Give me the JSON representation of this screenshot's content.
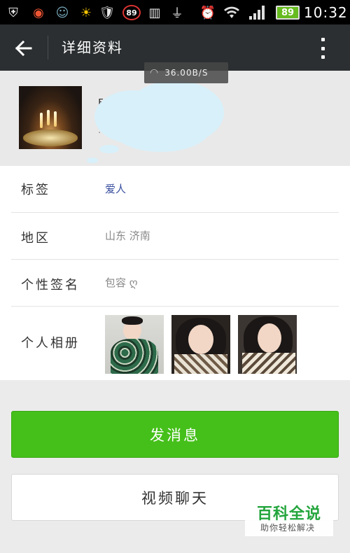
{
  "status_bar": {
    "notification_badge": "89",
    "battery_level": "89",
    "time": "10:32"
  },
  "header": {
    "title": "详细资料"
  },
  "network_overlay": {
    "speed": "36.00B/S"
  },
  "profile": {
    "rows": {
      "tag": {
        "label": "标签",
        "value": "爱人"
      },
      "region": {
        "label": "地区",
        "value": "山东 济南"
      },
      "signature": {
        "label": "个性签名",
        "value": "包容 ღ"
      },
      "album": {
        "label": "个人相册"
      }
    }
  },
  "actions": {
    "send_message": "发消息",
    "video_chat": "视频聊天"
  },
  "watermark": {
    "title": "百科全说",
    "subtitle": "助你轻松解决"
  },
  "colors": {
    "title_bar": "#2b2f31",
    "primary_button": "#45c01a",
    "tag_value": "#3a4fa0"
  }
}
